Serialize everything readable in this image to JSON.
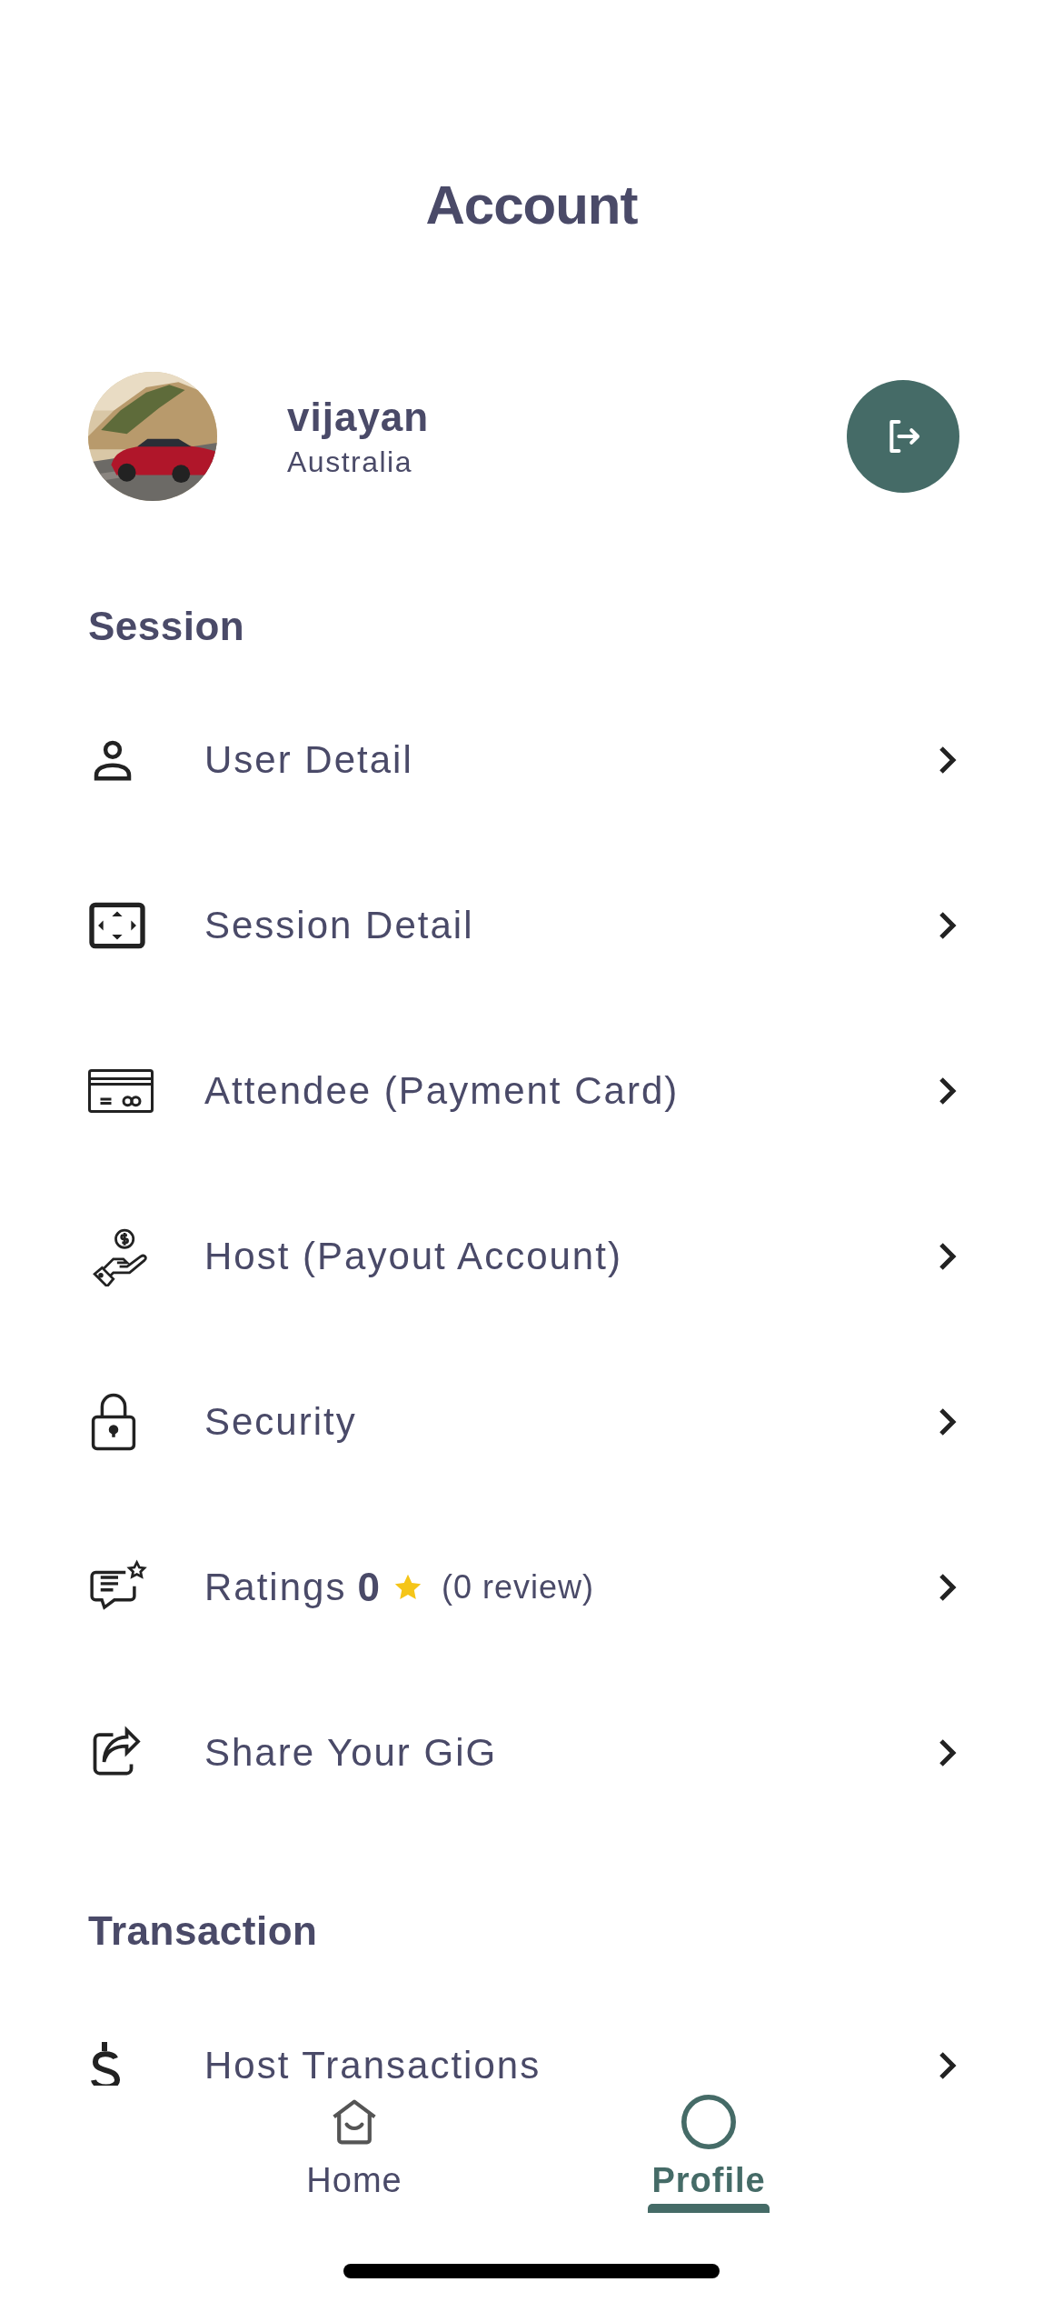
{
  "title": "Account",
  "profile": {
    "name": "vijayan",
    "location": "Australia"
  },
  "sections": [
    {
      "title": "Session",
      "items": [
        {
          "label": "User Detail"
        },
        {
          "label": "Session Detail"
        },
        {
          "label": "Attendee (Payment Card)"
        },
        {
          "label": "Host (Payout Account)"
        },
        {
          "label": "Security"
        },
        {
          "label": "Ratings",
          "value": "0",
          "reviews": "(0 review)"
        },
        {
          "label": "Share Your GiG"
        }
      ]
    },
    {
      "title": "Transaction",
      "items": [
        {
          "label": "Host Transactions"
        }
      ]
    }
  ],
  "tabs": [
    {
      "label": "Home",
      "selected": false
    },
    {
      "label": "Profile",
      "selected": true
    }
  ]
}
